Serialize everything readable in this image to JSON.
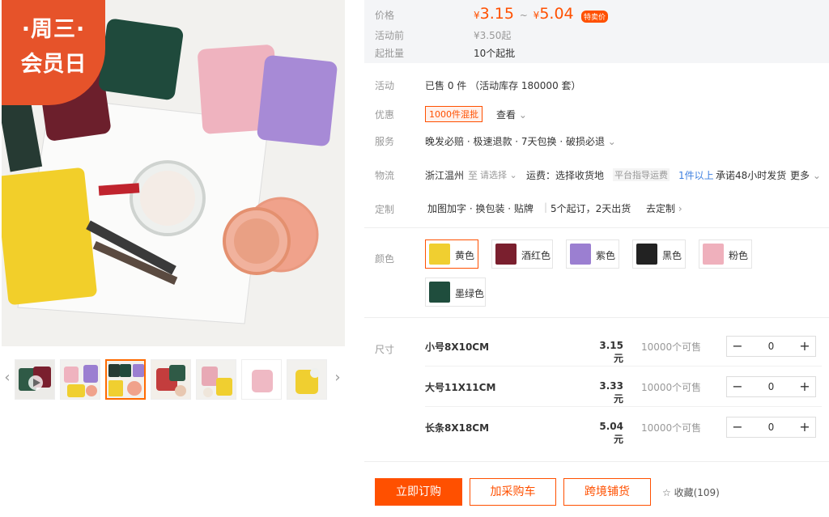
{
  "promo_badge": {
    "line1": "·周三·",
    "line2": "会员日"
  },
  "gallery": {
    "prev_icon": "chevron-left-icon",
    "next_icon": "chevron-right-icon",
    "thumb_colors": [
      "#2f5a46",
      "#e2c27a",
      "#7a9a6a",
      "#c33d3d",
      "#e8a9b5",
      "#efb9c4",
      "#f0cf30"
    ]
  },
  "price": {
    "label": "价格",
    "currency": "¥",
    "low": "3.15",
    "sep": "~",
    "high": "5.04",
    "tag": "特卖价"
  },
  "pre_activity": {
    "label": "活动前",
    "value": "¥3.50起"
  },
  "min_batch": {
    "label": "起批量",
    "value": "10个起批"
  },
  "activity": {
    "label": "活动",
    "value": "已售 0 件  （活动库存 180000 套）"
  },
  "discount": {
    "label": "优惠",
    "tag": "1000件混批",
    "link": "查看"
  },
  "service": {
    "label": "服务",
    "value": "晚发必赔 · 极速退款 · 7天包换 · 破损必退"
  },
  "logistics": {
    "label": "物流",
    "origin": "浙江温州",
    "to": "至",
    "select": "请选择",
    "freight": "运费：选择收货地",
    "platform": "平台指导运费",
    "qty": "1件以上",
    "promise": "承诺48小时发货",
    "more": "更多"
  },
  "custom": {
    "label": "定制",
    "value": "加图加字 · 换包装 · 贴牌",
    "moq": "5个起订，2天出货",
    "link": "去定制"
  },
  "colors": {
    "label": "颜色",
    "options": [
      {
        "name": "黄色",
        "swatch": "#f0cf30",
        "selected": true
      },
      {
        "name": "酒红色",
        "swatch": "#7a1f2e",
        "selected": false
      },
      {
        "name": "紫色",
        "swatch": "#9b7fd1",
        "selected": false
      },
      {
        "name": "黑色",
        "swatch": "#222222",
        "selected": false
      },
      {
        "name": "粉色",
        "swatch": "#efb0bc",
        "selected": false
      },
      {
        "name": "墨绿色",
        "swatch": "#1f4d3d",
        "selected": false
      }
    ]
  },
  "sizes": {
    "label": "尺寸",
    "rows": [
      {
        "name": "小号8X10CM",
        "price": "3.15元",
        "stock": "10000个可售",
        "qty": "0"
      },
      {
        "name": "大号11X11CM",
        "price": "3.33元",
        "stock": "10000个可售",
        "qty": "0"
      },
      {
        "name": "长条8X18CM",
        "price": "5.04元",
        "stock": "10000个可售",
        "qty": "0"
      }
    ],
    "minus": "−",
    "plus": "+"
  },
  "actions": {
    "buy": "立即订购",
    "cart": "加采购车",
    "cross": "跨境铺货",
    "favorite": "收藏(109)"
  }
}
